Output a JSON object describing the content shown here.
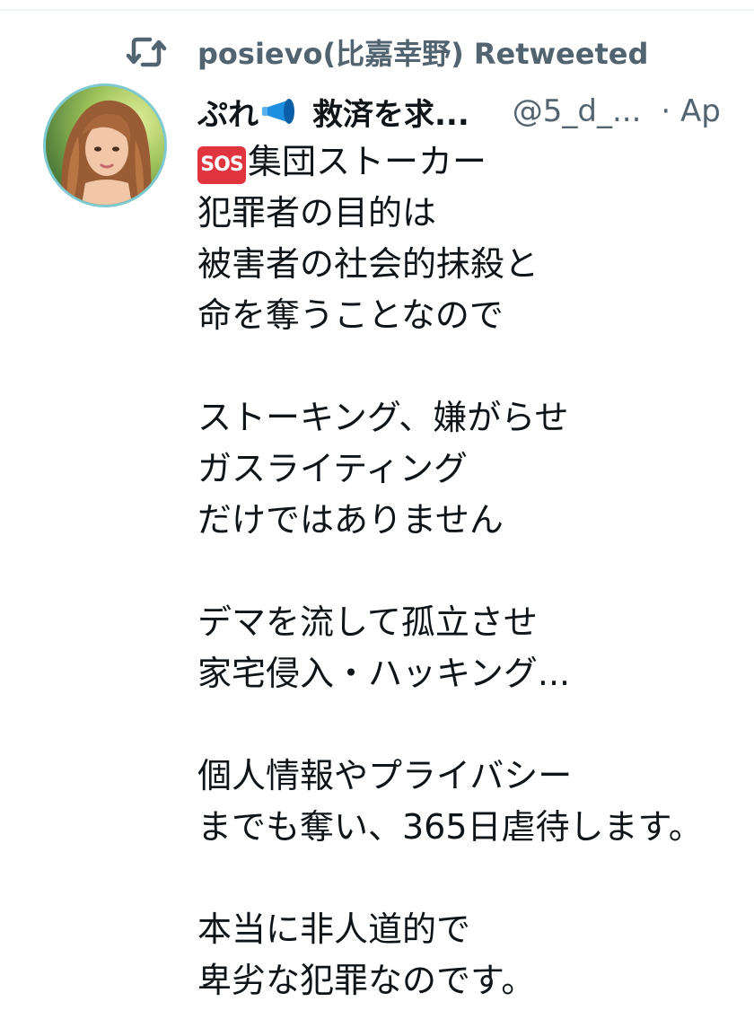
{
  "retweet": {
    "icon": "retweet-icon",
    "text": "posievo(比嘉幸野) Retweeted"
  },
  "author": {
    "avatar": "avatar",
    "name_prefix": "ぷれ",
    "name_icon": "megaphone-icon",
    "name_suffix": "救済を求...",
    "handle": "@5_d_...",
    "date": "· Ap"
  },
  "tweet": {
    "sos_badge": "SOS",
    "line1_rest": "集団ストーカー",
    "lines": [
      "犯罪者の目的は",
      "被害者の社会的抹殺と",
      "命を奪うことなので",
      "",
      "ストーキング、嫌がらせ",
      "ガスライティング",
      "だけではありません",
      "",
      "デマを流して孤立させ",
      "家宅侵入・ハッキング...",
      "",
      "個人情報やプライバシー",
      "までも奪い、365日虐待します。",
      "",
      "本当に非人道的で",
      "卑劣な犯罪なのです。"
    ]
  },
  "colors": {
    "text": "#0f1419",
    "secondary": "#536471",
    "sos": "#e0353e",
    "megaphone": "#1d8fe0"
  }
}
